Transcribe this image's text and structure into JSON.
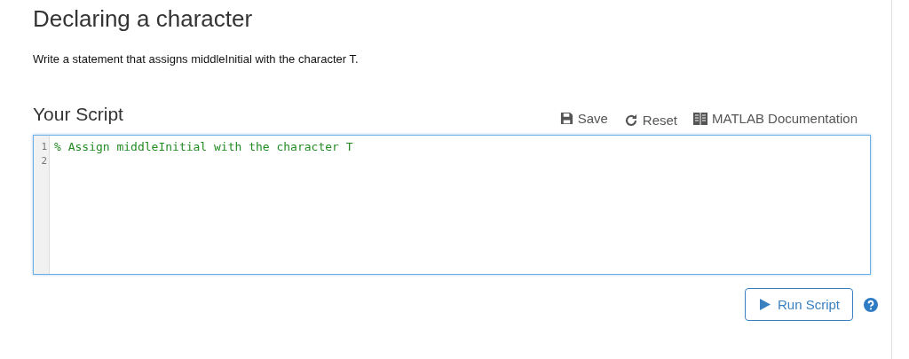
{
  "title": "Declaring a character",
  "instructions": "Write a statement that assigns middleInitial with the character T.",
  "script": {
    "heading": "Your Script",
    "actions": [
      {
        "kind": "save",
        "label": "Save"
      },
      {
        "kind": "reset",
        "label": "Reset"
      },
      {
        "kind": "docs",
        "label": "MATLAB Documentation"
      }
    ],
    "lines": [
      {
        "number": "1",
        "kind": "comment",
        "text": "% Assign middleInitial with the character T"
      },
      {
        "number": "2",
        "kind": "blank"
      }
    ]
  },
  "run_button": {
    "label": "Run Script"
  }
}
